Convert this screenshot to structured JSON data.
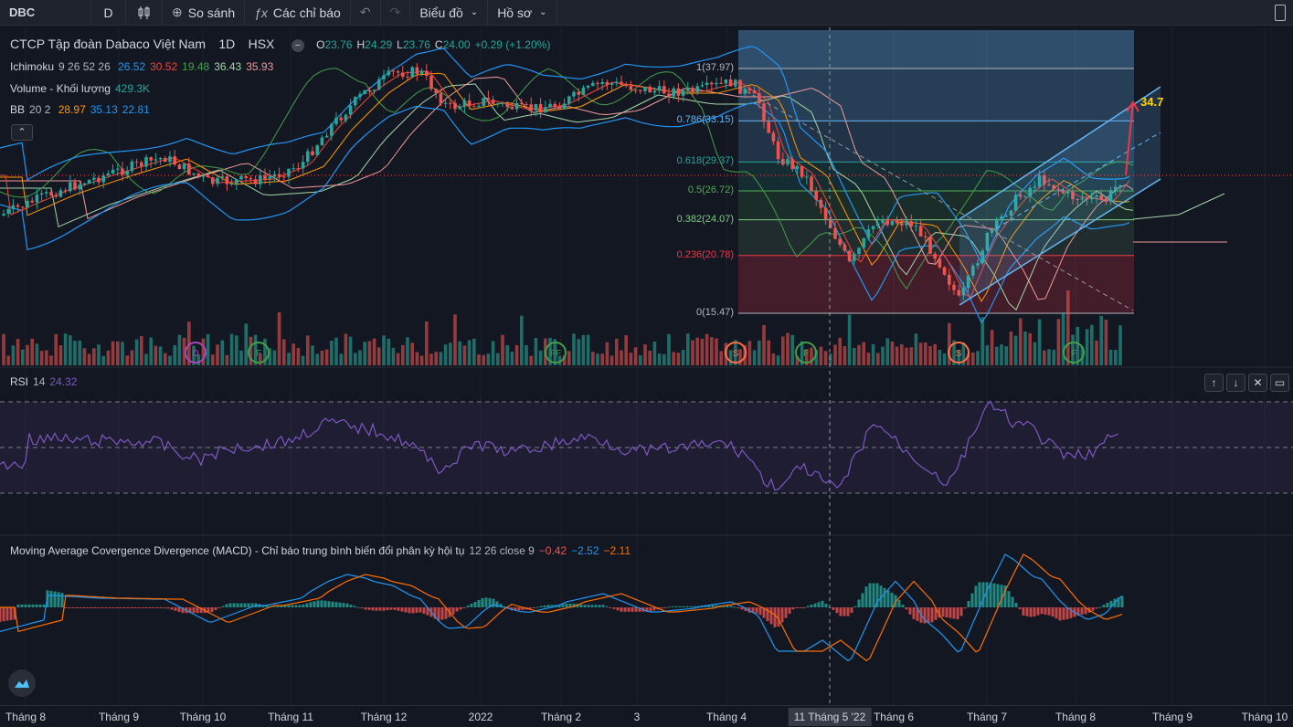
{
  "toolbar": {
    "symbol": "DBC",
    "interval": "D",
    "compare": "So sánh",
    "indicators": "Các chỉ báo",
    "chart_type": "Biểu đồ",
    "profile": "Hồ sơ"
  },
  "legend": {
    "title": "CTCP Tập đoàn Dabaco Việt Nam",
    "interval": "1D",
    "exchange": "HSX",
    "ohlc": {
      "o_label": "O",
      "o": "23.76",
      "h_label": "H",
      "h": "24.29",
      "l_label": "L",
      "l": "23.76",
      "c_label": "C",
      "c": "24.00",
      "change": "+0.29 (+1.20%)"
    },
    "ichimoku": {
      "name": "Ichimoku",
      "params": "9 26 52 26",
      "v1": "26.52",
      "v2": "30.52",
      "v3": "19.48",
      "v4": "36.43",
      "v5": "35.93"
    },
    "volume": {
      "name": "Volume - Khối lượng",
      "value": "429.3K"
    },
    "bb": {
      "name": "BB",
      "params": "20 2",
      "v1": "28.97",
      "v2": "35.13",
      "v3": "22.81"
    }
  },
  "fib_levels": [
    {
      "label": "1(37.97)",
      "price": 37.97,
      "color": "#b2b5be"
    },
    {
      "label": "0.786(33.15)",
      "price": 33.15,
      "color": "#64b5f6"
    },
    {
      "label": "0.618(29.37)",
      "price": 29.37,
      "color": "#26a69a"
    },
    {
      "label": "0.5(26.72)",
      "price": 26.72,
      "color": "#4caf50"
    },
    {
      "label": "0.382(24.07)",
      "price": 24.07,
      "color": "#81c784"
    },
    {
      "label": "0.236(20.78)",
      "price": 20.78,
      "color": "#f23645"
    },
    {
      "label": "0(15.47)",
      "price": 15.47,
      "color": "#b2b5be"
    }
  ],
  "target_label": "34.7",
  "signals": [
    "D",
    "F",
    "FF",
    "S",
    "F",
    "S",
    "F"
  ],
  "rsi": {
    "name": "RSI",
    "params": "14",
    "value": "24.32"
  },
  "macd": {
    "name": "Moving Average Covergence Divergence (MACD) - Chỉ báo trung bình biến đổi phân kỳ hội tụ",
    "params": "12 26 close 9",
    "v1": "−0.42",
    "v2": "−2.52",
    "v3": "−2.11"
  },
  "xaxis": {
    "labels": [
      "Tháng 8",
      "Tháng 9",
      "Tháng 10",
      "Tháng 11",
      "Tháng 12",
      "2022",
      "Tháng 2",
      "3",
      "Tháng 4",
      "Tháng 6",
      "Tháng 7",
      "Tháng 8",
      "Tháng 9",
      "Tháng 10"
    ],
    "cursor": "11 Tháng 5 '22"
  },
  "colors": {
    "up": "#26a69a",
    "down": "#ef5350",
    "rsi": "#7e57c2",
    "macd": "#2196f3",
    "signal": "#ff6d00",
    "bg": "#131722"
  }
}
